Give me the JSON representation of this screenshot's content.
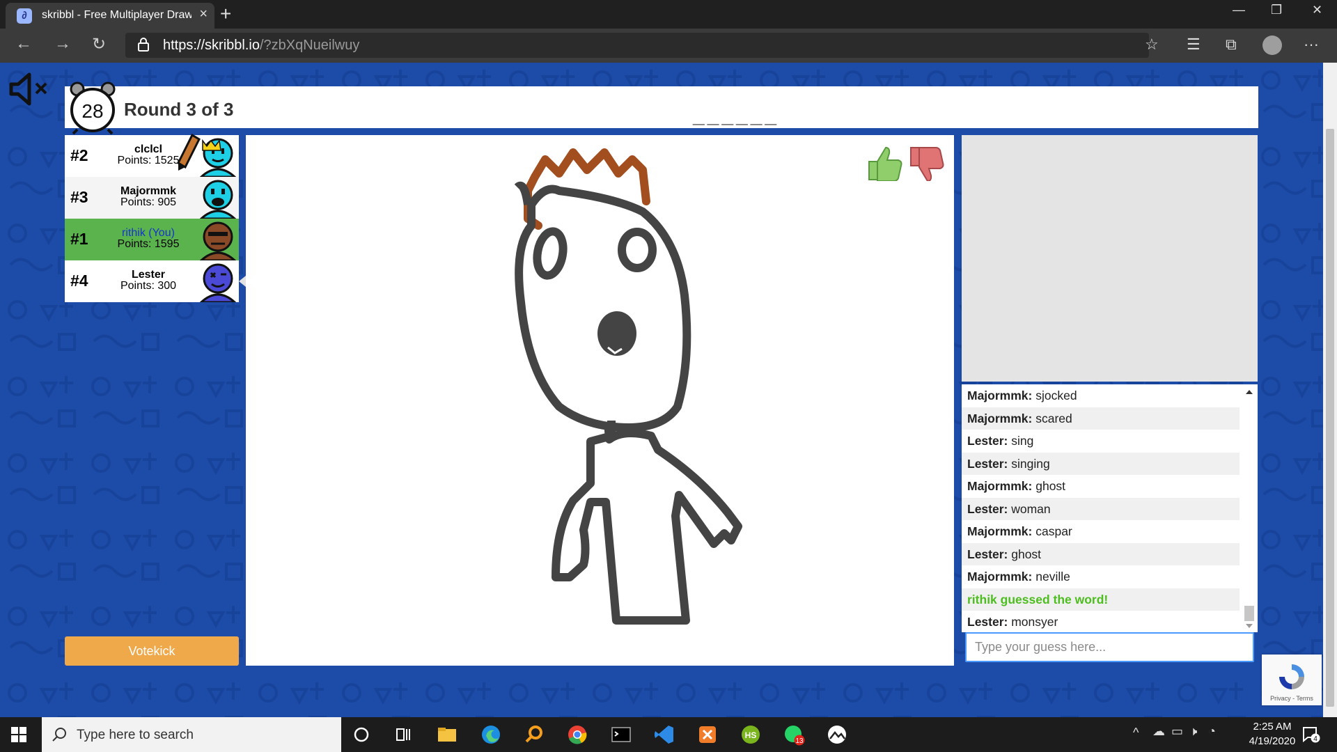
{
  "browser": {
    "tab_title": "skribbl - Free Multiplayer Drawing & Guessing Game",
    "url_host": "https://skribbl.io",
    "url_path": "/?zbXqNueilwuy"
  },
  "game": {
    "timer": "28",
    "round": "Round 3 of 3",
    "word_hint": "______"
  },
  "players": [
    {
      "rank": "#2",
      "name": "clclcl",
      "points": "Points: 1525",
      "is_you": false,
      "color": "#1ed0e6"
    },
    {
      "rank": "#3",
      "name": "Majormmk",
      "points": "Points: 905",
      "is_you": false,
      "color": "#1ed0e6"
    },
    {
      "rank": "#1",
      "name": "rithik (You)",
      "points": "Points: 1595",
      "is_you": true,
      "color": "#8a4a28"
    },
    {
      "rank": "#4",
      "name": "Lester",
      "points": "Points: 300",
      "is_you": false,
      "color": "#4a4ad6"
    }
  ],
  "speech_bubble": "monsyer",
  "votekick_label": "Votekick",
  "chat": [
    {
      "author": "Majormmk",
      "text": "sjocked"
    },
    {
      "author": "Majormmk",
      "text": "scared"
    },
    {
      "author": "Lester",
      "text": "sing"
    },
    {
      "author": "Lester",
      "text": "singing"
    },
    {
      "author": "Majormmk",
      "text": "ghost"
    },
    {
      "author": "Lester",
      "text": "woman"
    },
    {
      "author": "Majormmk",
      "text": "caspar"
    },
    {
      "author": "Lester",
      "text": "ghost"
    },
    {
      "author": "Majormmk",
      "text": "neville"
    },
    {
      "author": "",
      "text": "rithik guessed the word!",
      "system": true
    },
    {
      "author": "Lester",
      "text": "monsyer"
    }
  ],
  "guess_placeholder": "Type your guess here...",
  "recaptcha_terms": "Privacy - Terms",
  "taskbar": {
    "search_placeholder": "Type here to search",
    "time": "2:25 AM",
    "date": "4/19/2020",
    "notification_count": "4",
    "whatsapp_badge": "13"
  },
  "colors": {
    "background": "#1d4ba8",
    "you_highlight": "#5bb34e",
    "votekick": "#f0a94a",
    "guessed": "#4dbd1f"
  }
}
